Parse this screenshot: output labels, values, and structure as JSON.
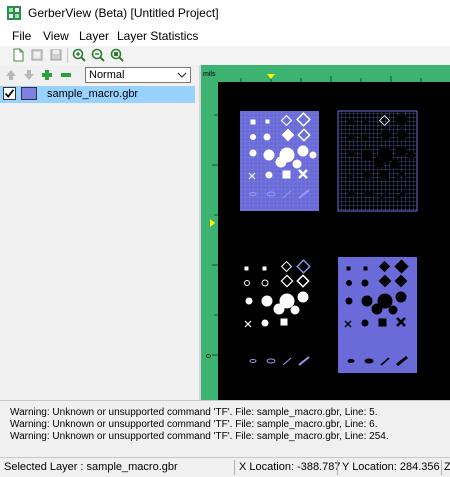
{
  "window": {
    "title": "GerberView (Beta) [Untitled Project]"
  },
  "menu": {
    "items": [
      "File",
      "View",
      "Layer",
      "Layer Statistics"
    ]
  },
  "toolbar": {
    "icons": [
      "new-file-icon",
      "open-file-icon",
      "save-icon",
      "zoom-in-icon",
      "zoom-out-icon",
      "zoom-fit-icon"
    ]
  },
  "layer_toolbar": {
    "icons": [
      "move-layer-up-icon",
      "move-layer-down-icon",
      "add-layer-icon",
      "remove-layer-icon"
    ],
    "blend_mode": "Normal"
  },
  "layers": [
    {
      "name": "sample_macro.gbr",
      "checked": true,
      "color": "#7f7fe6"
    }
  ],
  "canvas": {
    "ruler_unit": "mils",
    "ruler_zero": "0",
    "background": "#000000",
    "ruler_color": "#3cb371",
    "layer_color": "#6a6ad8"
  },
  "messages": [
    "Warning: Unknown or unsupported command 'TF'.  File: sample_macro.gbr, Line: 5.",
    "Warning: Unknown or unsupported command 'TF'.  File: sample_macro.gbr, Line: 6.",
    "Warning: Unknown or unsupported command 'TF'.  File: sample_macro.gbr, Line: 254."
  ],
  "status": {
    "selected_layer": "Selected Layer :  sample_macro.gbr",
    "x_location": "X Location:   -388.787",
    "y_location": "Y Location:  284.356",
    "z_location": "Z"
  }
}
